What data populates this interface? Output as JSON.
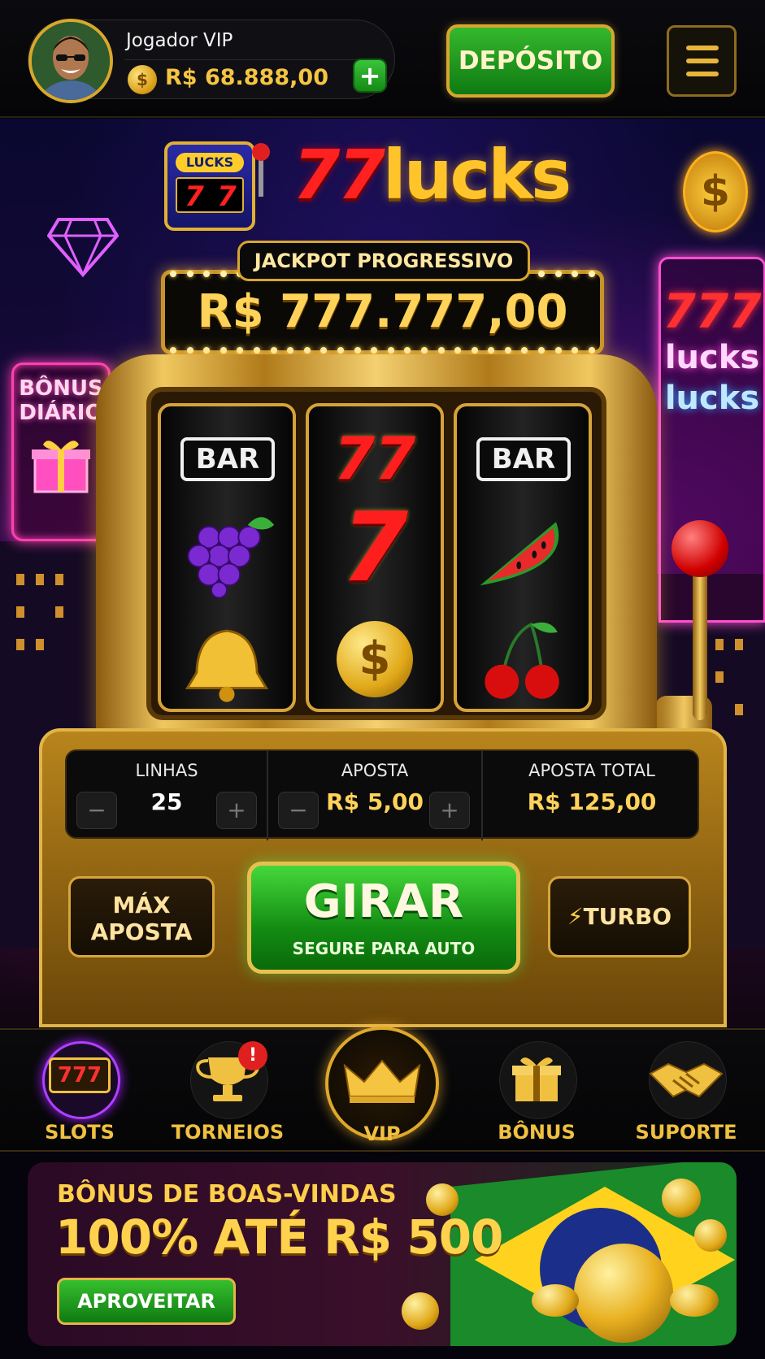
{
  "header": {
    "player_name": "Jogador VIP",
    "balance": "R$ 68.888,00",
    "coin_symbol": "$",
    "add_label": "+",
    "deposit_label": "DEPÓSITO"
  },
  "hero": {
    "logo_box_title": "LUCKS",
    "logo_box_digits": [
      "7",
      "7"
    ],
    "brand_number": "77",
    "brand_word": "lucks",
    "jackpot_label": "JACKPOT PROGRESSIVO",
    "jackpot_value": "R$ 777.777,00",
    "bonus_sign": "BÔNUS\nDIÁRIO",
    "neon_777": "777",
    "neon_lucks_1": "lucks",
    "neon_lucks_2": "lucks",
    "neon_dollar": "$"
  },
  "reels": {
    "bar_label": "BAR",
    "seven_double": "77",
    "seven_single": "7",
    "coin_symbol": "$"
  },
  "controls": {
    "lines": {
      "label": "LINHAS",
      "value": "25"
    },
    "bet": {
      "label": "APOSTA",
      "value": "R$ 5,00"
    },
    "total": {
      "label": "APOSTA TOTAL",
      "value": "R$ 125,00"
    },
    "minus": "−",
    "plus": "+",
    "max_bet_line1": "MÁX",
    "max_bet_line2": "APOSTA",
    "spin_label": "GIRAR",
    "spin_sub": "SEGURE PARA AUTO",
    "turbo_label": "TURBO"
  },
  "nav": {
    "items": [
      {
        "label": "SLOTS",
        "icon": "slot-machine-icon",
        "active": true
      },
      {
        "label": "TORNEIOS",
        "icon": "trophy-icon",
        "badge": "!"
      },
      {
        "label": "VIP",
        "icon": "crown-icon"
      },
      {
        "label": "BÔNUS",
        "icon": "gift-icon"
      },
      {
        "label": "SUPORTE",
        "icon": "handshake-icon"
      }
    ],
    "slots_icon_text": "777"
  },
  "promo": {
    "title": "BÔNUS DE BOAS-VINDAS",
    "amount": "100% ATÉ R$ 500",
    "button": "APROVEITAR"
  },
  "colors": {
    "gold": "#f5c542",
    "green": "#1a9a1a",
    "neon_pink": "#ff3fb0",
    "red": "#ff1e1e"
  }
}
